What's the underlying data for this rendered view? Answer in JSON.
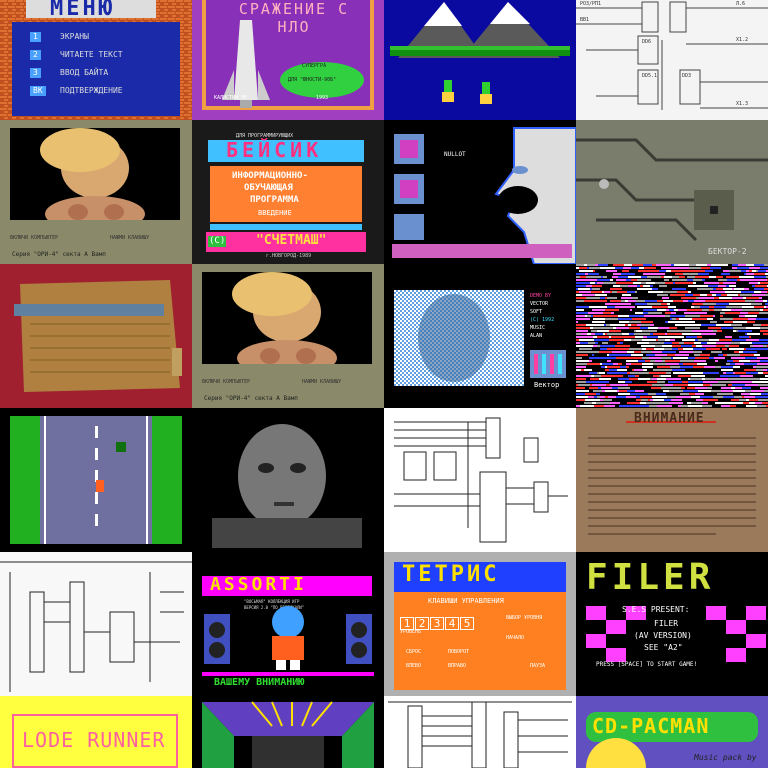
{
  "tiles": {
    "menu": {
      "title": "МЕНЮ",
      "items": [
        {
          "key": "1",
          "label": "ЭКРАНЫ"
        },
        {
          "key": "2",
          "label": "ЧИТАЕТЕ ТЕКСТ"
        },
        {
          "key": "3",
          "label": "ВВОД БАЙТА"
        },
        {
          "key": "ВК",
          "label": "ПОДТВЕРЖДЕНИЕ"
        }
      ]
    },
    "ufo": {
      "title": "СРАЖЕНИЕ С НЛО",
      "line1": "СУПЕРГРА",
      "line2": "ДЛЯ \"ЮНОСТИ-90Б\"",
      "author": "КАЛИСТИН ЭР",
      "year": "1993"
    },
    "mountains": {},
    "schematic1": {
      "labels": [
        "РОЗ/РП1",
        "ВВ1",
        "DD6",
        "DD5.1",
        "DD3",
        "Л.6",
        "Х1.2",
        "Х1.3"
      ]
    },
    "photo1": {
      "caption_left": "ВКЛЮЧИ КОМПЬЮТЕР",
      "caption_right": "НАЖМИ КЛАВИШУ",
      "footer": "Серия \"ОРИ-4\" секта А Вамп"
    },
    "basic": {
      "top_line": "ДЛЯ ПРОГРАММИРУЮЩИХ",
      "title": "БЕЙСИК",
      "subtitle1": "ИНФОРМАЦИОННО-",
      "subtitle2": "ОБУЧАЮЩАЯ",
      "subtitle3": "ПРОГРАММА",
      "intro": "ВВЕДЕНИЕ",
      "brand": "\"СЧЕТМАШ\"",
      "copyright": "(C)",
      "small": "г.НОВГОРОД-1989"
    },
    "profile": {
      "label": "NULLOT"
    },
    "pcb1": {
      "label": "БЕКТОР-2"
    },
    "pcb2": {},
    "photo2": {
      "caption_left": "ВКЛЮЧИ КОМПЬЮТЕР",
      "caption_right": "НАЖМИ КЛАВИШУ",
      "footer": "Серия \"ОРИ-4\" секта А Вамп"
    },
    "dither_face": {
      "side_text": [
        "DEMO BY",
        "VECTOR",
        "SOFT",
        "(C) 1992",
        "MUSIC",
        "ALAN"
      ],
      "footer": "Вектор"
    },
    "glitch": {},
    "road": {},
    "bw_face": {},
    "schematic2": {},
    "warning": {
      "title": "ВНИМАНИЕ"
    },
    "schematic3": {},
    "assorti": {
      "title": "ASSORTI",
      "line1": "\"ВОСЬМАЯ\" КОЛЛЕКЦИЯ ИГР",
      "line2": "ВЕРСИЯ 2.0 \"ПО ВЕРТИКАЛИ\"",
      "footer": "ВАШЕМУ ВНИМАНИЮ"
    },
    "tetris": {
      "title": "ТЕТРИС",
      "controls": "КЛАВИШИ УПРАВЛЕНИЯ",
      "digits": [
        "1",
        "2",
        "3",
        "4",
        "5"
      ],
      "level": "УРОВЕНЬ",
      "speed": "ВЫБОР УРОВНЯ",
      "start": "НАЧАЛО",
      "drop": "СБРОС",
      "turn": "ПОВОРОТ",
      "left": "ВЛЕВО",
      "right": "ВПРАВО",
      "pause": "ПАУЗА"
    },
    "filer": {
      "title": "FILER",
      "presents": "S.E.S PRESENT:",
      "name": "FILER",
      "version": "(AV VERSION)",
      "see": "SEE \"A2\"",
      "prompt": "PRESS [SPACE] TO START GAME!"
    },
    "loderunner": {
      "title": "LODE RUNNER"
    },
    "perspective": {},
    "schematic4": {},
    "pacman": {
      "title": "CD-PACMAN",
      "sub": "Music pack by"
    }
  }
}
